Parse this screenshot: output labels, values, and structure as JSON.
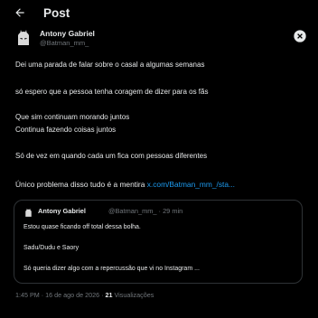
{
  "header": {
    "back_icon": "arrow-left-icon",
    "title": "Post"
  },
  "author": {
    "name": "Antony Gabriel",
    "handle": "@Batman_mm_",
    "close_icon": "close-icon"
  },
  "post": {
    "line1": "Dei uma parada de falar sobre o casal a algumas semanas",
    "line2": "só espero que a pessoa tenha coragem de dizer para os fãs",
    "line3": "Que sim continuam morando juntos",
    "line4": "Continua fazendo coisas juntos",
    "line5": "Só de vez em quando cada um fica com pessoas diferentes",
    "line6_text": "Único problema disso tudo é a mentira ",
    "line6_link": "x.com/Batman_mm_/sta..."
  },
  "quote": {
    "name": "Antony Gabriel",
    "handle_time": "@Batman_mm_ · 29 min",
    "line1": "Estou quase ficando off total dessa bolha.",
    "line2": "Sadu/Dudu e Saory",
    "line3": "Só queria dizer algo com a repercussão que vi no Instagram ..."
  },
  "footer": {
    "timestamp": "1:45 PM · 16 de ago de 2026 · ",
    "views_count": "21",
    "views_label": " Visualizações"
  },
  "colors": {
    "background": "#000000",
    "text": "#e7e9ea",
    "muted": "#71767b",
    "link": "#1d9bf0",
    "border": "#2f3336"
  }
}
